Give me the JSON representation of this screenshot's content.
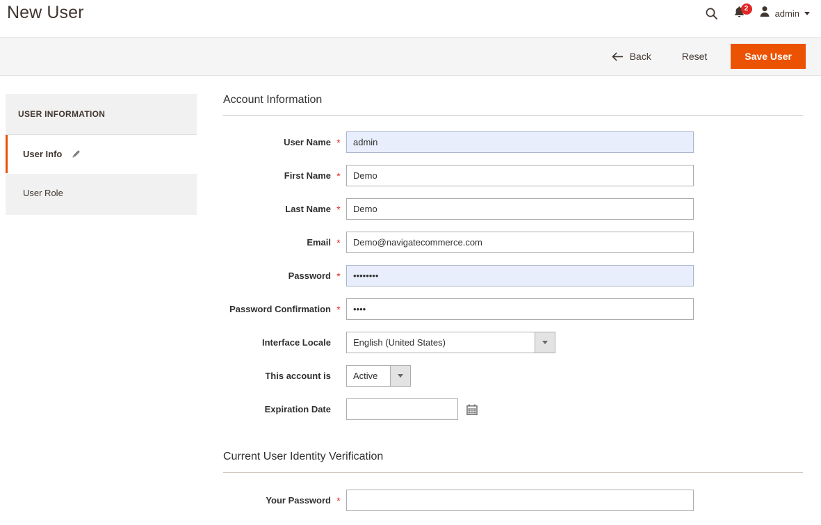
{
  "header": {
    "title": "New User",
    "search_icon": "search-icon",
    "notifications": {
      "icon": "bell-icon",
      "count": "2",
      "badge_color": "#e22626"
    },
    "account": {
      "avatar_icon": "user-avatar-icon",
      "name": "admin",
      "caret_icon": "chevron-down-icon"
    }
  },
  "toolbar": {
    "back_icon": "arrow-left-icon",
    "back_label": "Back",
    "reset_label": "Reset",
    "save_label": "Save User",
    "save_color": "#eb5202"
  },
  "sidebar": {
    "title": "USER INFORMATION",
    "items": [
      {
        "label": "User Info",
        "icon": "pencil-icon",
        "active": true
      },
      {
        "label": "User Role",
        "icon": "",
        "active": false
      }
    ]
  },
  "content": {
    "sections": [
      {
        "title": "Account Information",
        "fields": [
          {
            "label": "User Name",
            "required": "*",
            "value": "admin",
            "placeholder": "",
            "type": "text",
            "autofill": true
          },
          {
            "label": "First Name",
            "required": "*",
            "value": "Demo",
            "placeholder": "",
            "type": "text",
            "autofill": false
          },
          {
            "label": "Last Name",
            "required": "*",
            "value": "Demo",
            "placeholder": "",
            "type": "text",
            "autofill": false
          },
          {
            "label": "Email",
            "required": "*",
            "value": "Demo@navigatecommerce.com",
            "placeholder": "",
            "type": "text",
            "autofill": false
          },
          {
            "label": "Password",
            "required": "*",
            "value": "••••••••",
            "placeholder": "",
            "type": "password",
            "autofill": true
          },
          {
            "label": "Password Confirmation",
            "required": "*",
            "value": "••••",
            "placeholder": "",
            "type": "password",
            "autofill": false
          },
          {
            "label": "Interface Locale",
            "required": "",
            "value": "English (United States)",
            "type": "select"
          },
          {
            "label": "This account is",
            "required": "",
            "value": "Active",
            "type": "select-narrow"
          },
          {
            "label": "Expiration Date",
            "required": "",
            "value": "",
            "placeholder": "",
            "type": "date",
            "calendar_icon": "calendar-icon"
          }
        ]
      },
      {
        "title": "Current User Identity Verification",
        "fields": [
          {
            "label": "Your Password",
            "required": "*",
            "value": "",
            "placeholder": "",
            "type": "password",
            "autofill": false
          }
        ]
      }
    ]
  }
}
